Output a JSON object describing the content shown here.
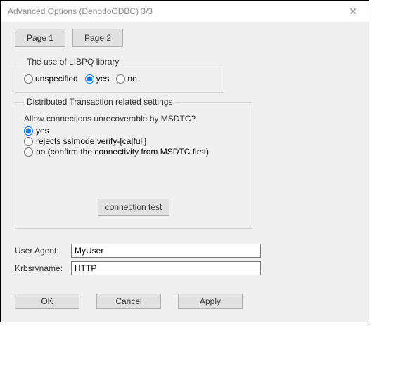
{
  "window": {
    "title": "Advanced Options (DenodoODBC) 3/3"
  },
  "pages": {
    "page1": "Page 1",
    "page2": "Page 2"
  },
  "libpq": {
    "legend": "The use of LIBPQ library",
    "options": {
      "unspecified": "unspecified",
      "yes": "yes",
      "no": "no"
    },
    "selected": "yes"
  },
  "dt": {
    "legend": "Distributed Transaction related settings",
    "question": "Allow connections unrecoverable by MSDTC?",
    "options": {
      "yes": "yes",
      "rejects": "rejects sslmode verify-[ca|full]",
      "no": "no (confirm the connectivity from MSDTC first)"
    },
    "selected": "yes",
    "connection_test": "connection test"
  },
  "fields": {
    "user_agent_label": "User Agent:",
    "user_agent_value": "MyUser",
    "krb_label": "Krbsrvname:",
    "krb_value": "HTTP"
  },
  "buttons": {
    "ok": "OK",
    "cancel": "Cancel",
    "apply": "Apply"
  }
}
